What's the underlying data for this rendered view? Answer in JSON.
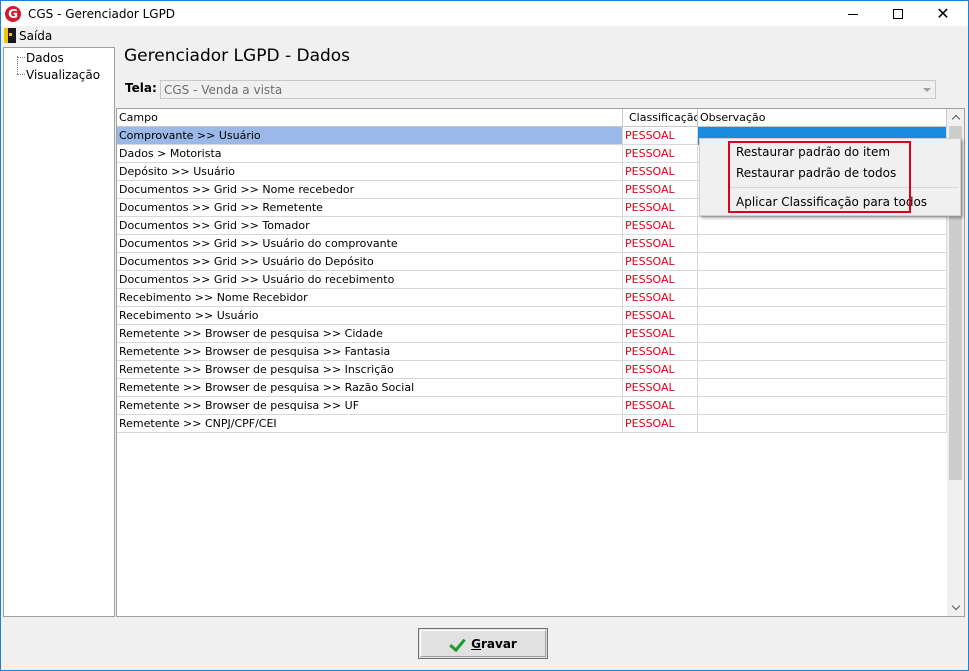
{
  "window": {
    "title": "CGS - Gerenciador LGPD",
    "icon": "app-logo-icon"
  },
  "menubar": {
    "items": [
      {
        "label": "Saída",
        "icon": "exit-door-icon"
      }
    ]
  },
  "tree": {
    "items": [
      {
        "label": "Dados"
      },
      {
        "label": "Visualização"
      }
    ]
  },
  "page": {
    "title": "Gerenciador LGPD - Dados"
  },
  "tela": {
    "label": "Tela:",
    "value": "CGS - Venda a vista"
  },
  "grid": {
    "columns": [
      "Campo",
      "Classificação",
      "Observação"
    ],
    "rows": [
      {
        "campo": "Comprovante >> Usuário",
        "classificacao": "PESSOAL",
        "observacao": "",
        "selected": true
      },
      {
        "campo": "Dados > Motorista",
        "classificacao": "PESSOAL",
        "observacao": ""
      },
      {
        "campo": "Depósito >> Usuário",
        "classificacao": "PESSOAL",
        "observacao": ""
      },
      {
        "campo": "Documentos >> Grid >> Nome recebedor",
        "classificacao": "PESSOAL",
        "observacao": ""
      },
      {
        "campo": "Documentos >> Grid >> Remetente",
        "classificacao": "PESSOAL",
        "observacao": ""
      },
      {
        "campo": "Documentos >> Grid >> Tomador",
        "classificacao": "PESSOAL",
        "observacao": ""
      },
      {
        "campo": "Documentos >> Grid >> Usuário do comprovante",
        "classificacao": "PESSOAL",
        "observacao": ""
      },
      {
        "campo": "Documentos >> Grid >> Usuário do Depósito",
        "classificacao": "PESSOAL",
        "observacao": ""
      },
      {
        "campo": "Documentos >> Grid >> Usuário do recebimento",
        "classificacao": "PESSOAL",
        "observacao": ""
      },
      {
        "campo": "Recebimento >> Nome Recebidor",
        "classificacao": "PESSOAL",
        "observacao": ""
      },
      {
        "campo": "Recebimento >> Usuário",
        "classificacao": "PESSOAL",
        "observacao": ""
      },
      {
        "campo": "Remetente >> Browser de pesquisa >> Cidade",
        "classificacao": "PESSOAL",
        "observacao": ""
      },
      {
        "campo": "Remetente >> Browser de pesquisa >> Fantasia",
        "classificacao": "PESSOAL",
        "observacao": ""
      },
      {
        "campo": "Remetente >> Browser de pesquisa >> Inscrição",
        "classificacao": "PESSOAL",
        "observacao": ""
      },
      {
        "campo": "Remetente >> Browser de pesquisa >> Razão Social",
        "classificacao": "PESSOAL",
        "observacao": ""
      },
      {
        "campo": "Remetente >> Browser de pesquisa >> UF",
        "classificacao": "PESSOAL",
        "observacao": ""
      },
      {
        "campo": "Remetente >> CNPJ/CPF/CEI",
        "classificacao": "PESSOAL",
        "observacao": ""
      }
    ]
  },
  "context_menu": {
    "items": [
      "Restaurar padrão do item",
      "Restaurar padrão de todos",
      "Aplicar Classificação para todos"
    ]
  },
  "footer": {
    "save_label": "Gravar",
    "save_mnemonic": "G"
  },
  "colors": {
    "classification_text": "#e0001b",
    "highlight_border": "#e0001b",
    "selection_blue": "#1a8be0",
    "selection_light": "#9bb9e8",
    "check_green": "#1a9c2c"
  }
}
